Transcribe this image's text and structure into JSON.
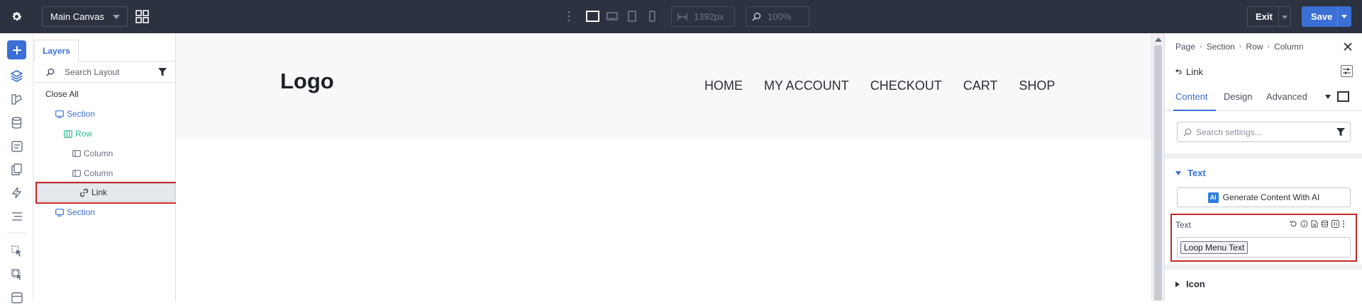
{
  "toolbar": {
    "canvas_select": "Main Canvas",
    "width_placeholder": "1392px",
    "zoom_placeholder": "100%",
    "exit_label": "Exit",
    "save_label": "Save"
  },
  "layers": {
    "tab_label": "Layers",
    "search_placeholder": "Search Layout",
    "close_all": "Close All",
    "tree": [
      {
        "label": "Section",
        "type": "section"
      },
      {
        "label": "Row",
        "type": "row"
      },
      {
        "label": "Column",
        "type": "column"
      },
      {
        "label": "Column",
        "type": "column"
      },
      {
        "label": "Link",
        "type": "link",
        "selected": true
      },
      {
        "label": "Section",
        "type": "section"
      }
    ]
  },
  "site": {
    "logo": "Logo",
    "nav": [
      "HOME",
      "MY ACCOUNT",
      "CHECKOUT",
      "CART",
      "SHOP"
    ]
  },
  "settings": {
    "breadcrumb": [
      "Page",
      "Section",
      "Row",
      "Column"
    ],
    "element_title": "Link",
    "tabs": [
      "Content",
      "Design",
      "Advanced"
    ],
    "active_tab": "Content",
    "search_placeholder": "Search settings...",
    "group_text": "Text",
    "ai_button": "Generate Content With AI",
    "ai_badge": "AI",
    "field_label": "Text",
    "field_value": "Loop Menu Text",
    "group_icon": "Icon"
  },
  "colors": {
    "topbar": "#2c3240",
    "accent": "#3b6fd6",
    "row_green": "#2fb88a",
    "highlight_red": "#c62828"
  }
}
